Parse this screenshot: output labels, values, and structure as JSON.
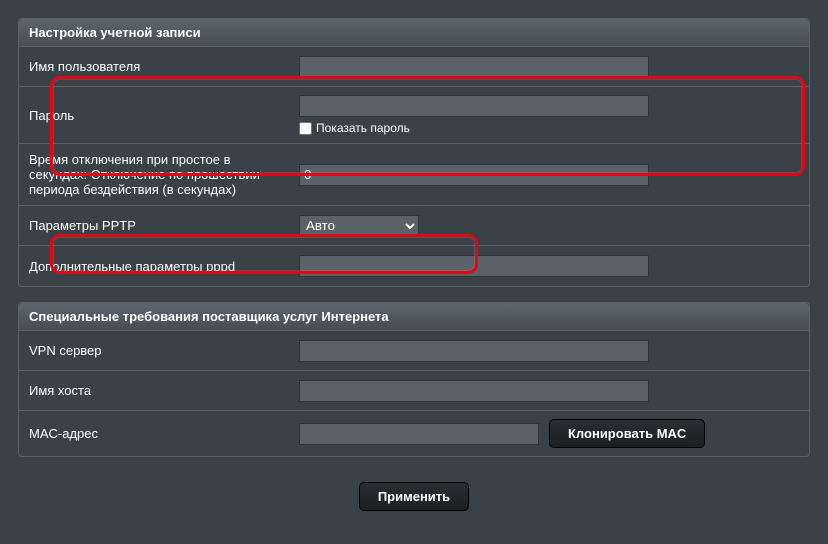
{
  "account": {
    "title": "Настройка учетной записи",
    "username_label": "Имя пользователя",
    "username_value": "",
    "password_label": "Пароль",
    "password_value": "",
    "show_password_label": "Показать пароль",
    "idle_label": "Время отключения при простое в секундах: Отключение по прошествии периода бездействия (в секундах)",
    "idle_value": "0",
    "pptp_label": "Параметры PPTP",
    "pptp_value": "Авто",
    "pppd_label": "Дополнительные параметры pppd",
    "pppd_value": ""
  },
  "isp": {
    "title": "Специальные требования поставщика услуг Интернета",
    "vpn_label": "VPN сервер",
    "vpn_value": "",
    "host_label": "Имя хоста",
    "host_value": "",
    "mac_label": "MAC-адрес",
    "mac_value": "",
    "mac_clone_button": "Клонировать MAC"
  },
  "apply_button": "Применить"
}
